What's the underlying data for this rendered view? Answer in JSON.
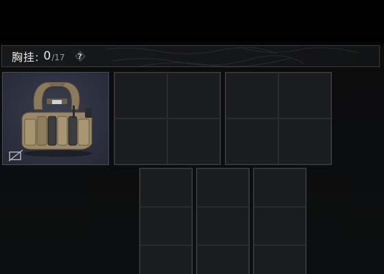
{
  "header": {
    "title": "胸挂:",
    "count": "0",
    "max": "/17",
    "help_label": "?",
    "help_icon": "question-diamond-icon"
  },
  "equipped": {
    "item_icon": "chest-rig-image",
    "lock_icon": "no-insure-icon",
    "bg_color": "#2e3140"
  },
  "containers": {
    "top_grids": [
      {
        "cols": 2,
        "rows": 2
      },
      {
        "cols": 2,
        "rows": 2
      }
    ],
    "bottom_grids": [
      {
        "cols": 1,
        "rows": 3
      },
      {
        "cols": 1,
        "rows": 3
      },
      {
        "cols": 1,
        "rows": 3
      }
    ]
  },
  "colors": {
    "background": "#0d0e0f",
    "cell": "#1b1c1e",
    "border": "#3d3e42",
    "text": "#e8e8e8"
  }
}
